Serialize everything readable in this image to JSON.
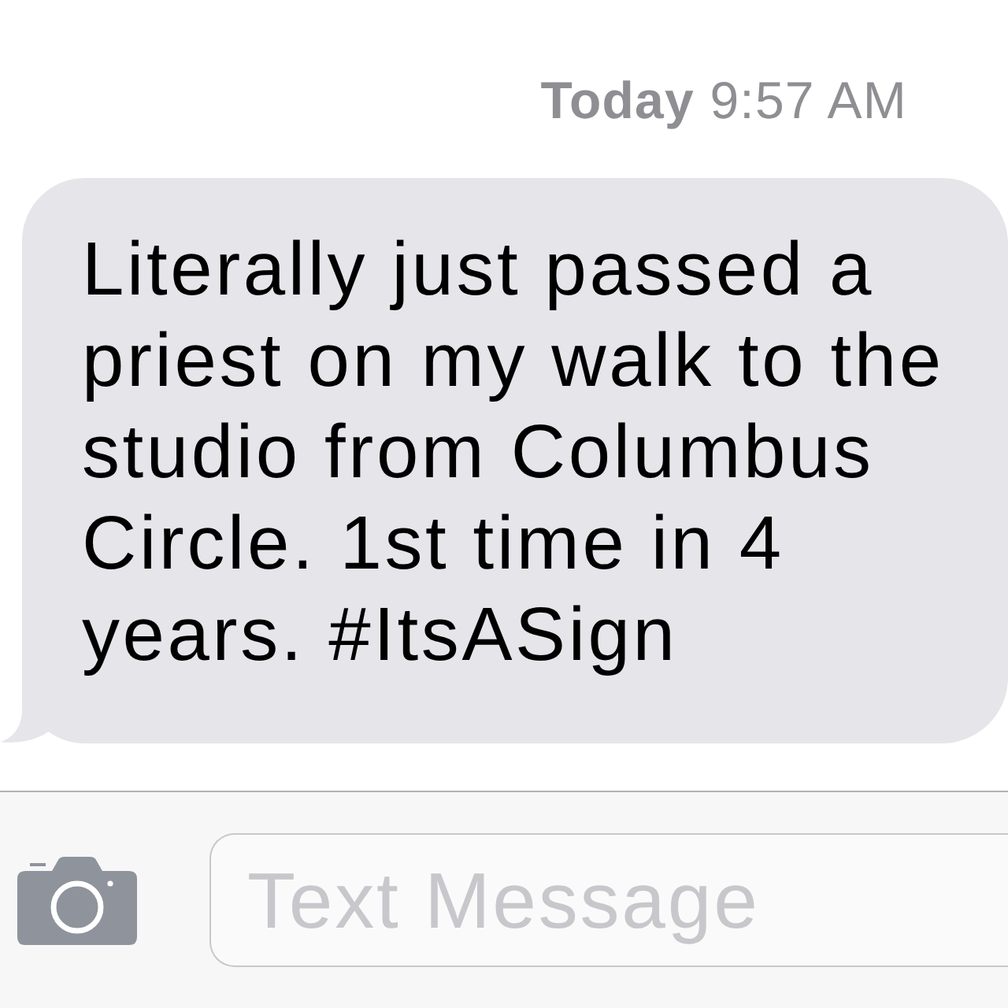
{
  "timestamp": {
    "text": "**Today** 9:57 AM"
  },
  "messages": [
    {
      "kind": "received",
      "text": "Literally just passed a priest on my walk to the studio from Columbus Circle. 1st time in 4 years. #ItsASign"
    }
  ],
  "composer": {
    "placeholder": "Text Message"
  }
}
